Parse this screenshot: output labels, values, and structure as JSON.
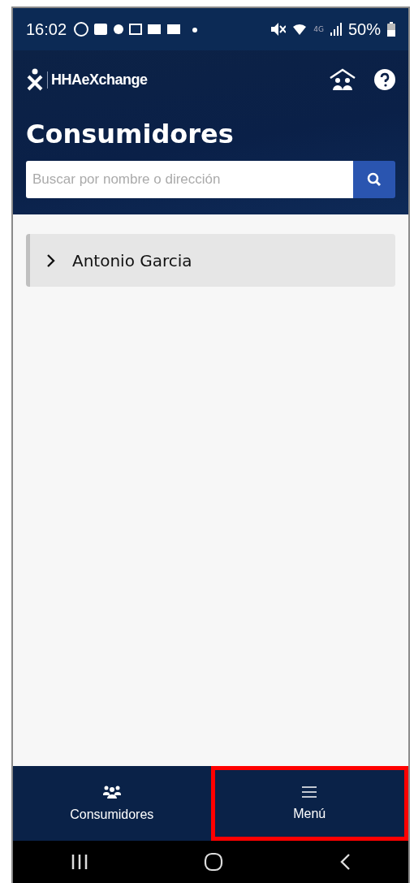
{
  "status_bar": {
    "time": "16:02",
    "battery": "50%",
    "network": "4G"
  },
  "header": {
    "logo": "HHAeXchange",
    "title": "Consumidores"
  },
  "search": {
    "placeholder": "Buscar por nombre o dirección"
  },
  "consumers": [
    {
      "name": "Antonio Garcia",
      "expanded": false
    }
  ],
  "bottom_nav": [
    {
      "label": "Consumidores",
      "kind": "people",
      "highlighted": false
    },
    {
      "label": "Menú",
      "kind": "menu",
      "highlighted": true
    }
  ]
}
